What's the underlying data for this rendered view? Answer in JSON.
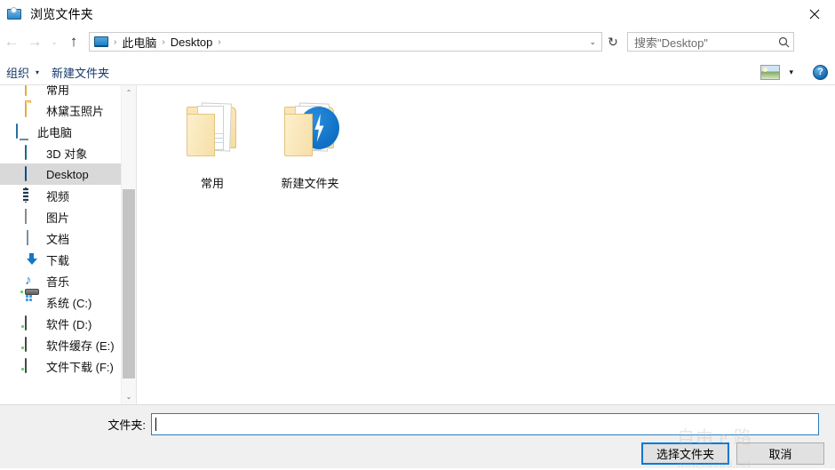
{
  "window": {
    "title": "浏览文件夹",
    "icon": "browse-folder-icon",
    "close_label": "✕"
  },
  "nav": {
    "back_label": "←",
    "forward_label": "→",
    "history_label": "⌄",
    "up_label": "↑",
    "refresh_label": "↻",
    "breadcrumb": {
      "root_icon": "this-pc-monitor-icon",
      "separator": "›",
      "items": [
        "此电脑",
        "Desktop"
      ]
    },
    "dropdown_label": "⌄"
  },
  "search": {
    "placeholder": "搜索\"Desktop\"",
    "icon": "search-icon"
  },
  "toolbar": {
    "organize_label": "组织",
    "organize_caret": "▾",
    "new_folder_label": "新建文件夹",
    "view_icon": "view-options-icon",
    "view_caret": "▾",
    "help_label": "?"
  },
  "sidebar": {
    "items": [
      {
        "label": "常用",
        "icon": "folder-icon",
        "type": "folder",
        "indent": "child",
        "selected": false
      },
      {
        "label": "林黛玉照片",
        "icon": "folder-icon",
        "type": "folder",
        "indent": "child",
        "selected": false
      },
      {
        "label": "此电脑",
        "icon": "this-pc-icon",
        "type": "monitor",
        "indent": "root",
        "selected": false
      },
      {
        "label": "3D 对象",
        "icon": "cube-icon",
        "type": "cube",
        "indent": "child",
        "selected": false
      },
      {
        "label": "Desktop",
        "icon": "desktop-icon",
        "type": "desktop",
        "indent": "child",
        "selected": true
      },
      {
        "label": "视频",
        "icon": "videos-icon",
        "type": "film",
        "indent": "child",
        "selected": false
      },
      {
        "label": "图片",
        "icon": "pictures-icon",
        "type": "picture",
        "indent": "child",
        "selected": false
      },
      {
        "label": "文档",
        "icon": "documents-icon",
        "type": "document",
        "indent": "child",
        "selected": false
      },
      {
        "label": "下载",
        "icon": "downloads-icon",
        "type": "download",
        "indent": "child",
        "selected": false
      },
      {
        "label": "音乐",
        "icon": "music-icon",
        "type": "music",
        "indent": "child",
        "selected": false
      },
      {
        "label": "系统 (C:)",
        "icon": "system-drive-icon",
        "type": "sysdrive",
        "indent": "child",
        "selected": false
      },
      {
        "label": "软件 (D:)",
        "icon": "drive-icon",
        "type": "drive",
        "indent": "child",
        "selected": false
      },
      {
        "label": "软件缓存 (E:)",
        "icon": "drive-icon",
        "type": "drive",
        "indent": "child",
        "selected": false
      },
      {
        "label": "文件下载 (F:)",
        "icon": "drive-icon",
        "type": "drive",
        "indent": "child",
        "selected": false
      }
    ],
    "scroll_up_label": "⌃",
    "scroll_down_label": "⌄"
  },
  "files": [
    {
      "label": "常用",
      "icon": "folder-with-spreadsheet-icon",
      "thumb": "spreadsheet"
    },
    {
      "label": "新建文件夹",
      "icon": "folder-with-bolt-icon",
      "thumb": "bolt"
    }
  ],
  "footer": {
    "folder_label": "文件夹:",
    "folder_value": "",
    "select_button": "选择文件夹",
    "cancel_button": "取消"
  },
  "watermark": {
    "top": "自由 e 路",
    "bottom": "www.xdowd.net"
  },
  "colors": {
    "accent": "#0078d7",
    "selection": "#d9d9d9",
    "toolbar_text": "#15396b",
    "footer_bg": "#f0f0f0"
  }
}
